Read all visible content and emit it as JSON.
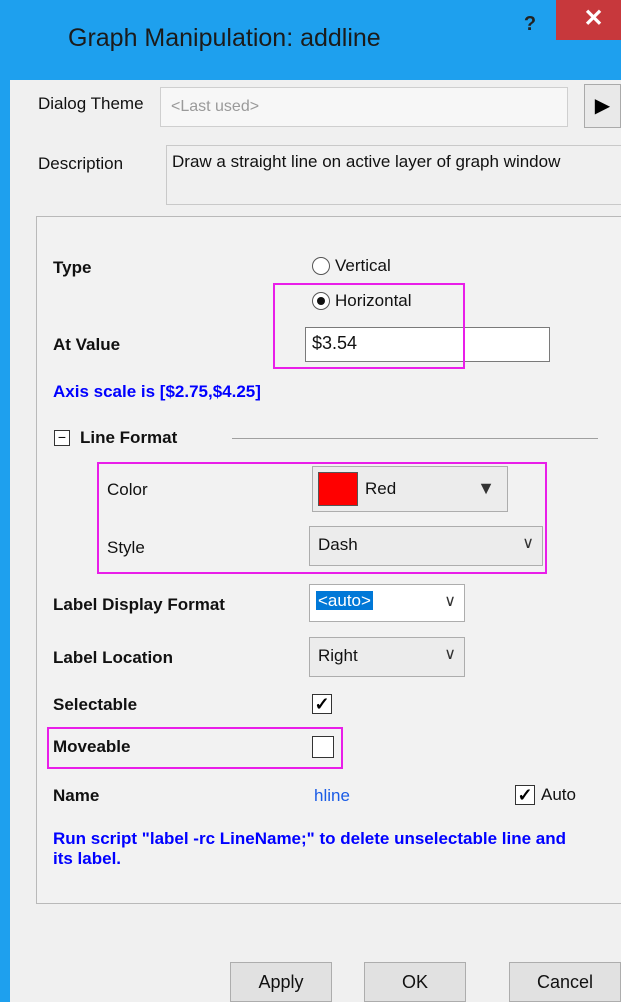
{
  "window": {
    "title": "Graph Manipulation: addline",
    "help": "?",
    "close": "✕"
  },
  "theme": {
    "label": "Dialog Theme",
    "value": "<Last used>",
    "arrow": "▶"
  },
  "description": {
    "label": "Description",
    "text": "Draw a straight line on active layer of graph window"
  },
  "type": {
    "label": "Type",
    "options": [
      "Vertical",
      "Horizontal"
    ],
    "selected": "Horizontal"
  },
  "at_value": {
    "label": "At Value",
    "value": "$3.54"
  },
  "axis_note": "Axis scale is [$2.75,$4.25]",
  "line_format": {
    "header": "Line Format",
    "toggle": "−",
    "color": {
      "label": "Color",
      "value": "Red",
      "swatch": "#ff0000",
      "arrow": "▼"
    },
    "style": {
      "label": "Style",
      "value": "Dash",
      "chevron": "∨"
    }
  },
  "label_display": {
    "label": "Label Display Format",
    "value": "<auto>",
    "chevron": "∨"
  },
  "label_location": {
    "label": "Label Location",
    "value": "Right",
    "chevron": "∨"
  },
  "selectable": {
    "label": "Selectable",
    "checked": true,
    "mark": "✓"
  },
  "moveable": {
    "label": "Moveable",
    "checked": false
  },
  "name": {
    "label": "Name",
    "value": "hline",
    "auto_label": "Auto",
    "auto_mark": "✓"
  },
  "script_note": "Run script \"label -rc LineName;\" to delete unselectable line and its label.",
  "buttons": {
    "apply": "Apply",
    "ok": "OK",
    "cancel": "Cancel"
  },
  "colors": {
    "accent": "#1ea0ee",
    "highlight": "#e91ee9",
    "note": "#0000ff"
  }
}
